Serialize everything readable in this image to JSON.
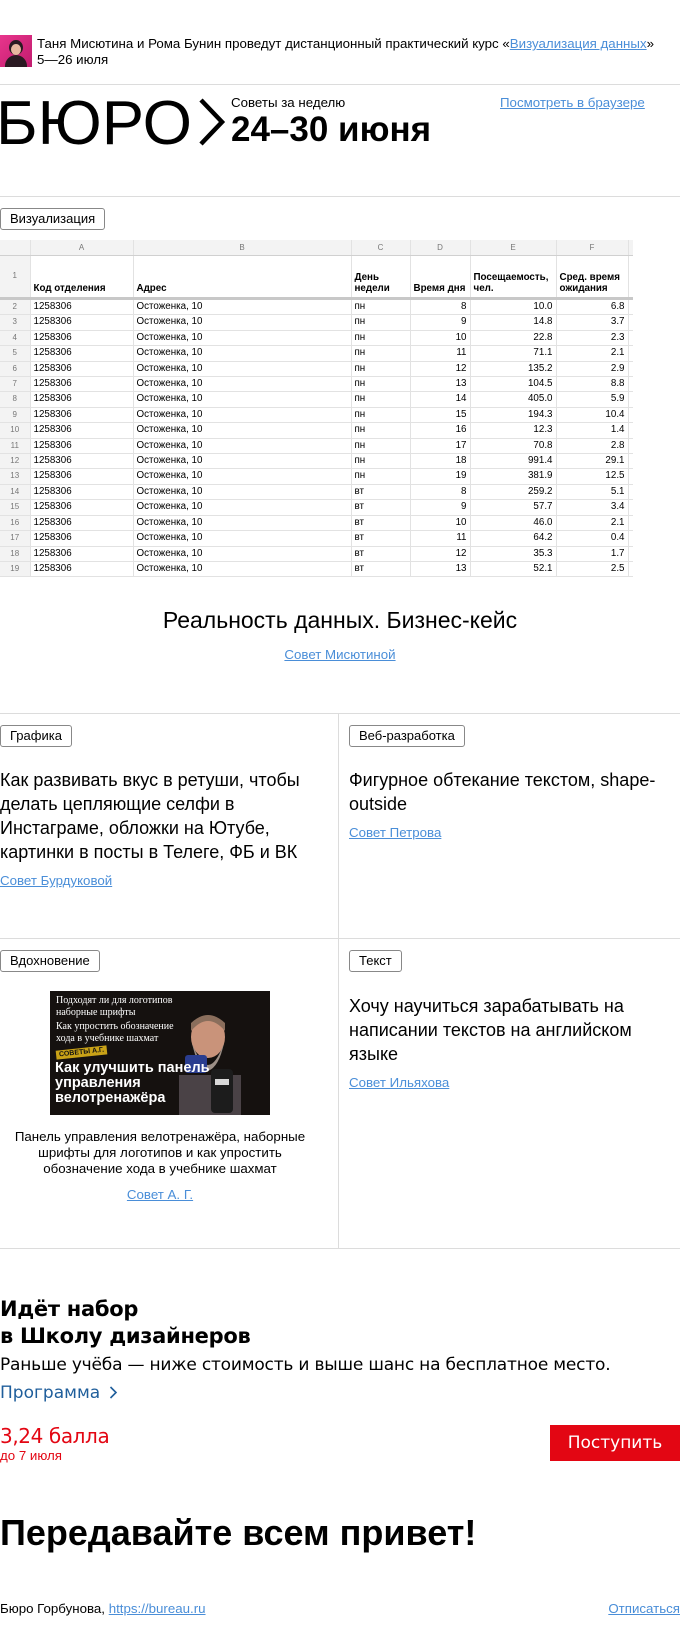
{
  "banner": {
    "text_before": "Таня Мисютина и Рома Бунин проведут дистанционный практический курс «",
    "course_link": "Визуализация данных",
    "text_after": "»",
    "dates": "5—26 июля"
  },
  "header": {
    "logo_text": "БЮРО",
    "week_label": "Советы за неделю",
    "week_dates": "24–30 июня",
    "browser_link": "Посмотреть в браузере"
  },
  "feature": {
    "tag": "Визуализация",
    "spreadsheet": {
      "col_letters": [
        "A",
        "B",
        "C",
        "D",
        "E",
        "F"
      ],
      "headers": [
        "Код отделения",
        "Адрес",
        "День недели",
        "Время дня",
        "Посещаемость, чел.",
        "Сред. время ожидания"
      ],
      "rows": [
        [
          "2",
          "1258306",
          "Остоженка, 10",
          "пн",
          "8",
          "10.0",
          "6.8"
        ],
        [
          "3",
          "1258306",
          "Остоженка, 10",
          "пн",
          "9",
          "14.8",
          "3.7"
        ],
        [
          "4",
          "1258306",
          "Остоженка, 10",
          "пн",
          "10",
          "22.8",
          "2.3"
        ],
        [
          "5",
          "1258306",
          "Остоженка, 10",
          "пн",
          "11",
          "71.1",
          "2.1"
        ],
        [
          "6",
          "1258306",
          "Остоженка, 10",
          "пн",
          "12",
          "135.2",
          "2.9"
        ],
        [
          "7",
          "1258306",
          "Остоженка, 10",
          "пн",
          "13",
          "104.5",
          "8.8"
        ],
        [
          "8",
          "1258306",
          "Остоженка, 10",
          "пн",
          "14",
          "405.0",
          "5.9"
        ],
        [
          "9",
          "1258306",
          "Остоженка, 10",
          "пн",
          "15",
          "194.3",
          "10.4"
        ],
        [
          "10",
          "1258306",
          "Остоженка, 10",
          "пн",
          "16",
          "12.3",
          "1.4"
        ],
        [
          "11",
          "1258306",
          "Остоженка, 10",
          "пн",
          "17",
          "70.8",
          "2.8"
        ],
        [
          "12",
          "1258306",
          "Остоженка, 10",
          "пн",
          "18",
          "991.4",
          "29.1"
        ],
        [
          "13",
          "1258306",
          "Остоженка, 10",
          "пн",
          "19",
          "381.9",
          "12.5"
        ],
        [
          "14",
          "1258306",
          "Остоженка, 10",
          "вт",
          "8",
          "259.2",
          "5.1"
        ],
        [
          "15",
          "1258306",
          "Остоженка, 10",
          "вт",
          "9",
          "57.7",
          "3.4"
        ],
        [
          "16",
          "1258306",
          "Остоженка, 10",
          "вт",
          "10",
          "46.0",
          "2.1"
        ],
        [
          "17",
          "1258306",
          "Остоженка, 10",
          "вт",
          "11",
          "64.2",
          "0.4"
        ],
        [
          "18",
          "1258306",
          "Остоженка, 10",
          "вт",
          "12",
          "35.3",
          "1.7"
        ],
        [
          "19",
          "1258306",
          "Остоженка, 10",
          "вт",
          "13",
          "52.1",
          "2.5"
        ]
      ]
    },
    "title": "Реальность данных. Бизнес-кейс",
    "link": "Совет Мисютиной"
  },
  "cards": [
    {
      "tag": "Графика",
      "title": "Как развивать вкус в ретуши, чтобы делать цепляющие селфи в Инстаграме, обложки на Ютубе, картинки в посты в Телеге, ФБ и ВК",
      "link": "Совет Бурдуковой"
    },
    {
      "tag": "Веб-разработка",
      "title": "Фигурное обтекание текстом, shape-outside",
      "link": "Совет Петрова"
    },
    {
      "tag": "Вдохновение",
      "thumb_top": "Подходят ли для логотипов наборные шрифты",
      "thumb_mid": "Как упростить обозначение хода в учебнике шахмат",
      "thumb_badge": "СОВЕТЫ А.Г.",
      "thumb_big": "Как улучшить панель управления велотренажёра",
      "caption": "Панель управления велотренажёра, наборные шрифты для логотипов и как упростить обозначение хода в учебнике шахмат",
      "link": "Совет А. Г."
    },
    {
      "tag": "Текст",
      "title": "Хочу научиться зарабатывать на написании текстов на английском языке",
      "link": "Совет Ильяхова"
    }
  ],
  "school": {
    "title_line1": "Идёт набор",
    "title_line2": "в Школу дизайнеров",
    "subtitle": "Раньше учёба — ниже стоимость и выше шанс на бесплатное место.",
    "program_link": "Программа",
    "score": "3,24 балла",
    "deadline": "до 7 июля",
    "apply_button": "Поступить"
  },
  "greeting": "Передавайте всем привет!",
  "footer": {
    "name": "Бюро Горбунова, ",
    "site": "https://bureau.ru",
    "unsubscribe": "Отписаться"
  },
  "colors": {
    "link": "#4a8ed8",
    "accent_red": "#e30613",
    "program_blue": "#1f5e9b"
  }
}
